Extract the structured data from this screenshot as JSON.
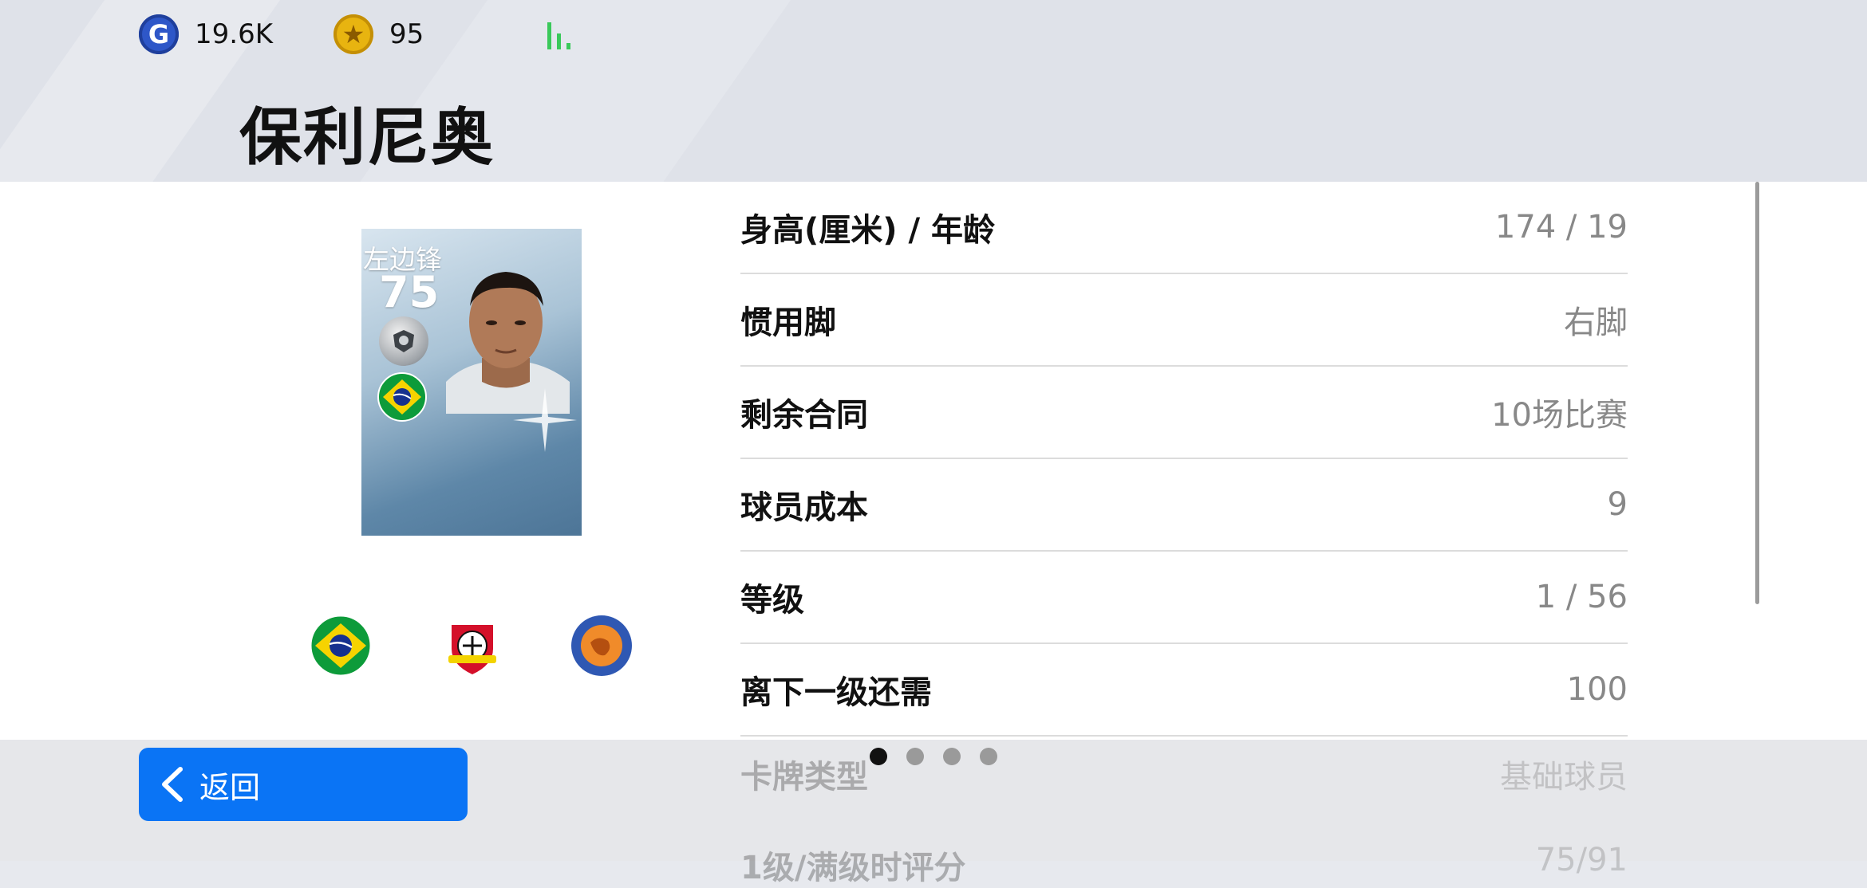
{
  "header": {
    "gp": "19.6K",
    "coins": "95",
    "player_name": "保利尼奥"
  },
  "card": {
    "position": "左边锋",
    "rating": "75"
  },
  "details": [
    {
      "label": "身高(厘米) / 年龄",
      "value": "174 / 19"
    },
    {
      "label": "惯用脚",
      "value": "右脚"
    },
    {
      "label": "剩余合同",
      "value": "10场比赛"
    },
    {
      "label": "球员成本",
      "value": "9"
    },
    {
      "label": "等级",
      "value": "1 / 56"
    },
    {
      "label": "离下一级还需",
      "value": "100"
    }
  ],
  "faded_rows": [
    {
      "label": "卡牌类型",
      "value": "基础球员"
    },
    {
      "label": "1级/满级时评分",
      "value": "75/91"
    }
  ],
  "back_label": "返回",
  "pagination": {
    "total": 4,
    "active": 0
  },
  "colors": {
    "accent": "#0a74f5",
    "signal": "#3ac95a"
  }
}
